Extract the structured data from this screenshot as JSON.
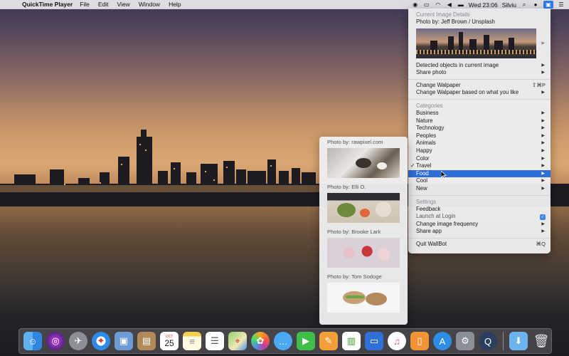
{
  "menubar": {
    "app_name": "QuickTime Player",
    "menus": [
      "File",
      "Edit",
      "View",
      "Window",
      "Help"
    ],
    "clock": "Wed 23:06",
    "user": "Silviu"
  },
  "wallbot_menu": {
    "current_header": "Current Image Details",
    "photo_by": "Photo by: Jeff Brown / Unsplash",
    "detected_objects": "Detected objects in current image",
    "share_photo": "Share photo",
    "change_wallpaper": "Change Walpaper",
    "change_wallpaper_shortcut": "⇧⌘P",
    "change_wallpaper_based": "Change Walpaper based on what you like",
    "categories_header": "Categories",
    "categories": [
      "Business",
      "Nature",
      "Technology",
      "Peoples",
      "Animals",
      "Happy",
      "Color",
      "Travel",
      "Food",
      "Cool",
      "New"
    ],
    "checked_category": "Travel",
    "highlighted_category": "Food",
    "settings_header": "Settings",
    "feedback": "Feedback",
    "launch_at_login": "Launch at Login",
    "change_frequency": "Change image frequency",
    "share_app": "Share app",
    "quit": "Quit WallBot",
    "quit_shortcut": "⌘Q"
  },
  "food_submenu": {
    "photos": [
      {
        "credit": "Photo by: rawpixel.com"
      },
      {
        "credit": "Photo by: Elli O."
      },
      {
        "credit": "Photo by: Brooke Lark"
      },
      {
        "credit": "Photo by: Tom Sodoge"
      }
    ]
  },
  "dock": {
    "calendar_month": "OCT",
    "calendar_day": "25"
  }
}
